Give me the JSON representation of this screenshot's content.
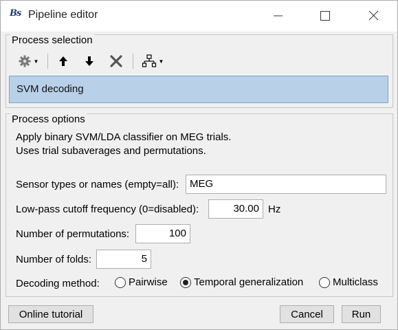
{
  "window": {
    "logo_text": "Bs",
    "title": "Pipeline editor"
  },
  "process_selection": {
    "label": "Process selection",
    "toolbar": {
      "icons": [
        "gear-icon",
        "arrow-up-icon",
        "arrow-down-icon",
        "delete-icon",
        "pipeline-tree-icon"
      ]
    },
    "processes": [
      "SVM decoding"
    ],
    "selected_color": "#b8d0e8"
  },
  "process_options": {
    "label": "Process options",
    "description": [
      "Apply binary SVM/LDA classifier on MEG trials.",
      "Uses trial subaverages and permutations."
    ],
    "sensor_types": {
      "label": "Sensor types or names (empty=all):",
      "value": "MEG"
    },
    "lowpass": {
      "label": "Low-pass cutoff frequency (0=disabled):",
      "value": "30.00",
      "unit": "Hz"
    },
    "permutations": {
      "label": "Number of permutations:",
      "value": "100"
    },
    "folds": {
      "label": "Number of folds:",
      "value": "5"
    },
    "decoding": {
      "label": "Decoding method:",
      "options": [
        "Pairwise",
        "Temporal generalization",
        "Multiclass"
      ],
      "selected": "Temporal generalization"
    }
  },
  "buttons": {
    "online_tutorial": "Online tutorial",
    "cancel": "Cancel",
    "run": "Run"
  }
}
